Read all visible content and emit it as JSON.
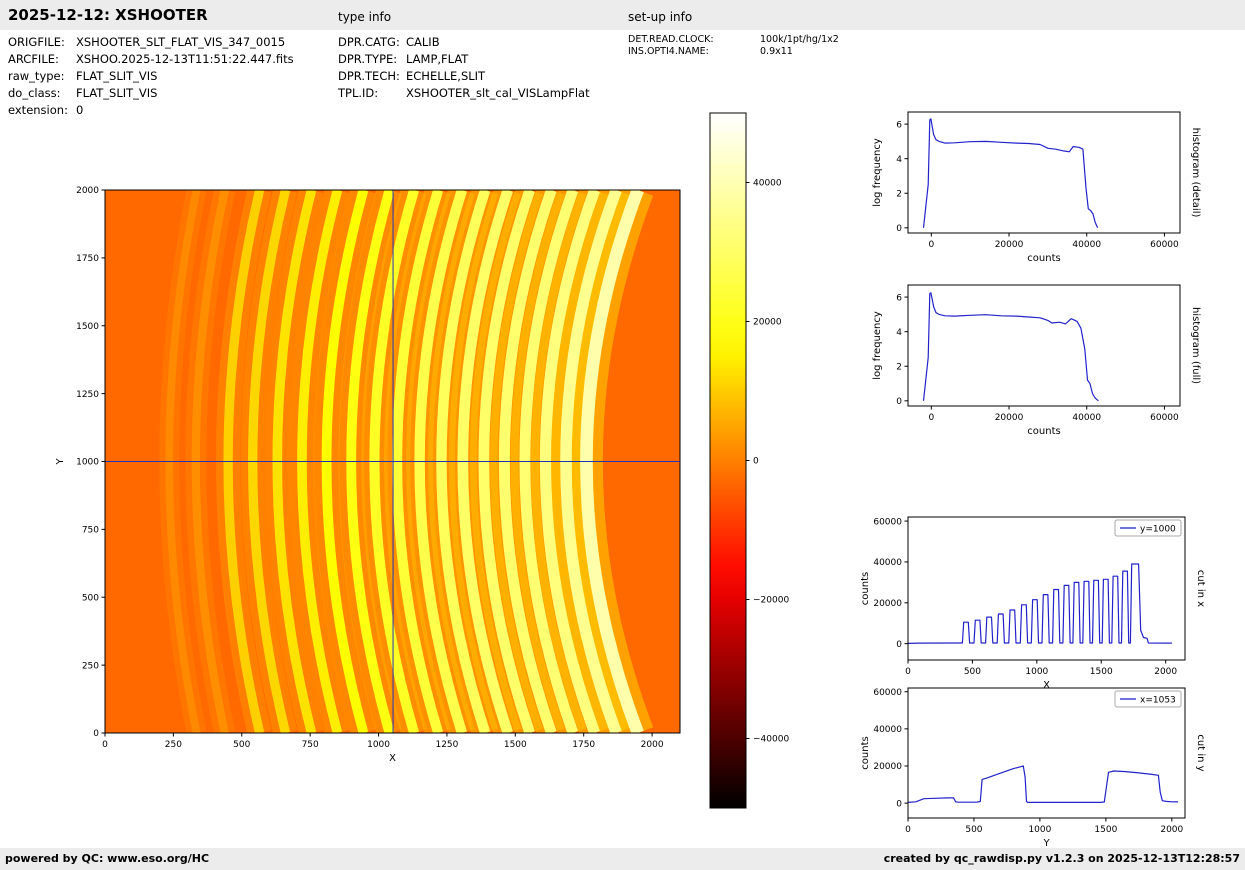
{
  "header": {
    "title": "2025-12-12: XSHOOTER",
    "type_info_label": "type info",
    "setup_info_label": "set-up info"
  },
  "file_info": {
    "rows": [
      {
        "label": "ORIGFILE:",
        "value": "XSHOOTER_SLT_FLAT_VIS_347_0015"
      },
      {
        "label": "ARCFILE:",
        "value": "XSHOO.2025-12-13T11:51:22.447.fits"
      },
      {
        "label": "raw_type:",
        "value": "FLAT_SLIT_VIS"
      },
      {
        "label": "do_class:",
        "value": "FLAT_SLIT_VIS"
      },
      {
        "label": "extension:",
        "value": "0"
      }
    ]
  },
  "type_info": {
    "rows": [
      {
        "label": "DPR.CATG:",
        "value": "CALIB"
      },
      {
        "label": "DPR.TYPE:",
        "value": "LAMP,FLAT"
      },
      {
        "label": "DPR.TECH:",
        "value": "ECHELLE,SLIT"
      },
      {
        "label": "TPL.ID:",
        "value": "XSHOOTER_slt_cal_VISLampFlat"
      }
    ]
  },
  "setup_info": {
    "rows": [
      {
        "label": "DET.READ.CLOCK:",
        "value": "100k/1pt/hg/1x2"
      },
      {
        "label": "INS.OPTI4.NAME:",
        "value": "0.9x11"
      }
    ]
  },
  "footer": {
    "left": "powered by QC: www.eso.org/HC",
    "right": "created by qc_rawdisp.py v1.2.3 on 2025-12-13T12:28:57"
  },
  "chart_data": [
    {
      "id": "main_image",
      "type": "heatmap",
      "xlabel": "X",
      "ylabel": "Y",
      "xlim": [
        0,
        2102
      ],
      "ylim": [
        0,
        2000
      ],
      "xticks": [
        0,
        250,
        500,
        750,
        1000,
        1250,
        1500,
        1750,
        2000
      ],
      "yticks": [
        0,
        250,
        500,
        750,
        1000,
        1250,
        1500,
        1750,
        2000
      ],
      "colormap": "hot",
      "vmin": -50000,
      "vmax": 50000,
      "background_counts": -3000,
      "colorbar_ticks": [
        40000,
        20000,
        0,
        -20000,
        -40000
      ],
      "crosshair": {
        "x": 1053,
        "y": 1000,
        "color": "#2233bb"
      },
      "description": "XSHOOTER VIS lamp flat: ~17 curved echelle orders, brightness increasing from left (~10000 counts) to right (~39000 counts) on an orange background, blue crosshair at x=1053 y=1000",
      "orders": [
        {
          "x": 235,
          "w": 28,
          "p": 1200,
          "d": 100
        },
        {
          "x": 332,
          "w": 30,
          "p": 2000,
          "d": 106
        },
        {
          "x": 450,
          "w": 34,
          "p": 10500,
          "d": 115
        },
        {
          "x": 540,
          "w": 34,
          "p": 11500,
          "d": 120
        },
        {
          "x": 630,
          "w": 35,
          "p": 13000,
          "d": 125
        },
        {
          "x": 720,
          "w": 35,
          "p": 14500,
          "d": 130
        },
        {
          "x": 810,
          "w": 36,
          "p": 16500,
          "d": 135
        },
        {
          "x": 900,
          "w": 36,
          "p": 19000,
          "d": 140
        },
        {
          "x": 985,
          "w": 37,
          "p": 21500,
          "d": 145
        },
        {
          "x": 1068,
          "w": 37,
          "p": 24000,
          "d": 150
        },
        {
          "x": 1150,
          "w": 38,
          "p": 26500,
          "d": 155
        },
        {
          "x": 1230,
          "w": 38,
          "p": 28500,
          "d": 160
        },
        {
          "x": 1308,
          "w": 39,
          "p": 30000,
          "d": 165
        },
        {
          "x": 1385,
          "w": 39,
          "p": 30500,
          "d": 168
        },
        {
          "x": 1460,
          "w": 40,
          "p": 31000,
          "d": 172
        },
        {
          "x": 1535,
          "w": 40,
          "p": 31500,
          "d": 176
        },
        {
          "x": 1610,
          "w": 41,
          "p": 33000,
          "d": 180
        },
        {
          "x": 1685,
          "w": 42,
          "p": 35500,
          "d": 184
        },
        {
          "x": 1760,
          "w": 46,
          "p": 39000,
          "d": 188
        }
      ]
    },
    {
      "id": "histogram_detail",
      "type": "line",
      "right_label": "histogram (detail)",
      "xlabel": "counts",
      "ylabel": "log frequency",
      "line_color": "#2222cc",
      "xlim": [
        -6000,
        64000
      ],
      "ylim": [
        -0.3,
        6.7
      ],
      "xticks": [
        0,
        20000,
        40000,
        60000
      ],
      "yticks": [
        0,
        2,
        4,
        6
      ],
      "x": [
        -2000,
        -800,
        -400,
        -100,
        200,
        600,
        1200,
        2000,
        3500,
        6000,
        10000,
        14000,
        18000,
        22000,
        25000,
        28000,
        30000,
        32000,
        34000,
        35500,
        36500,
        38000,
        39000,
        39800,
        40400,
        41000,
        41600,
        42200,
        42800
      ],
      "y": [
        0,
        2.5,
        6.25,
        6.3,
        5.9,
        5.4,
        5.1,
        5.0,
        4.9,
        4.92,
        4.98,
        5.0,
        4.95,
        4.9,
        4.88,
        4.82,
        4.6,
        4.55,
        4.45,
        4.4,
        4.7,
        4.66,
        4.55,
        2.3,
        1.1,
        1.0,
        0.8,
        0.3,
        0
      ]
    },
    {
      "id": "histogram_full",
      "type": "line",
      "right_label": "histogram (full)",
      "xlabel": "counts",
      "ylabel": "log frequency",
      "line_color": "#2222cc",
      "xlim": [
        -6000,
        64000
      ],
      "ylim": [
        -0.3,
        6.7
      ],
      "xticks": [
        0,
        20000,
        40000,
        60000
      ],
      "yticks": [
        0,
        2,
        4,
        6
      ],
      "x": [
        -2000,
        -800,
        -400,
        -100,
        200,
        600,
        1200,
        2000,
        3500,
        6000,
        10000,
        14000,
        18000,
        22000,
        25000,
        28000,
        30000,
        31000,
        33000,
        34500,
        36000,
        37500,
        38500,
        39500,
        40200,
        40800,
        41500,
        42200,
        43000
      ],
      "y": [
        0,
        2.5,
        6.2,
        6.25,
        5.9,
        5.45,
        5.1,
        5.0,
        4.92,
        4.9,
        4.95,
        4.98,
        4.92,
        4.9,
        4.85,
        4.8,
        4.65,
        4.5,
        4.55,
        4.45,
        4.75,
        4.6,
        4.2,
        3.0,
        1.2,
        1.0,
        0.4,
        0.15,
        0
      ]
    },
    {
      "id": "cut_in_x",
      "type": "line",
      "right_label": "cut in x",
      "legend_label": "y=1000",
      "xlabel": "X",
      "ylabel": "counts",
      "line_color": "#2222cc",
      "xlim": [
        0,
        2150
      ],
      "ylim": [
        -8000,
        62000
      ],
      "xticks": [
        0,
        500,
        1000,
        1500,
        2000
      ],
      "yticks": [
        0,
        20000,
        40000,
        60000
      ],
      "points": [
        [
          0,
          150
        ],
        [
          80,
          250
        ],
        [
          360,
          300
        ],
        [
          415,
          300
        ],
        [
          422,
          300
        ],
        [
          432,
          10500
        ],
        [
          468,
          10500
        ],
        [
          478,
          300
        ],
        [
          512,
          300
        ],
        [
          522,
          11500
        ],
        [
          558,
          11500
        ],
        [
          568,
          300
        ],
        [
          602,
          300
        ],
        [
          612,
          13000
        ],
        [
          648,
          13000
        ],
        [
          658,
          300
        ],
        [
          692,
          300
        ],
        [
          702,
          14500
        ],
        [
          738,
          14500
        ],
        [
          748,
          300
        ],
        [
          782,
          300
        ],
        [
          792,
          16500
        ],
        [
          828,
          16500
        ],
        [
          838,
          300
        ],
        [
          872,
          300
        ],
        [
          882,
          19000
        ],
        [
          918,
          19000
        ],
        [
          928,
          300
        ],
        [
          957,
          300
        ],
        [
          967,
          21500
        ],
        [
          1003,
          21500
        ],
        [
          1013,
          300
        ],
        [
          1040,
          300
        ],
        [
          1050,
          24000
        ],
        [
          1086,
          24000
        ],
        [
          1096,
          300
        ],
        [
          1122,
          300
        ],
        [
          1132,
          26500
        ],
        [
          1168,
          26500
        ],
        [
          1178,
          300
        ],
        [
          1202,
          300
        ],
        [
          1212,
          28500
        ],
        [
          1248,
          28500
        ],
        [
          1258,
          300
        ],
        [
          1280,
          300
        ],
        [
          1290,
          30000
        ],
        [
          1326,
          30000
        ],
        [
          1336,
          300
        ],
        [
          1357,
          300
        ],
        [
          1367,
          30500
        ],
        [
          1403,
          30500
        ],
        [
          1413,
          300
        ],
        [
          1432,
          300
        ],
        [
          1442,
          31000
        ],
        [
          1478,
          31000
        ],
        [
          1488,
          300
        ],
        [
          1507,
          300
        ],
        [
          1517,
          31500
        ],
        [
          1553,
          31500
        ],
        [
          1563,
          300
        ],
        [
          1582,
          300
        ],
        [
          1592,
          33000
        ],
        [
          1628,
          33000
        ],
        [
          1638,
          300
        ],
        [
          1657,
          300
        ],
        [
          1667,
          35500
        ],
        [
          1703,
          35500
        ],
        [
          1713,
          300
        ],
        [
          1726,
          300
        ],
        [
          1736,
          39000
        ],
        [
          1790,
          39000
        ],
        [
          1806,
          6500
        ],
        [
          1828,
          3000
        ],
        [
          1856,
          2600
        ],
        [
          1866,
          300
        ],
        [
          2048,
          250
        ]
      ]
    },
    {
      "id": "cut_in_y",
      "type": "line",
      "right_label": "cut in y",
      "legend_label": "x=1053",
      "xlabel": "Y",
      "ylabel": "counts",
      "line_color": "#2222cc",
      "xlim": [
        0,
        2100
      ],
      "ylim": [
        -8000,
        62000
      ],
      "xticks": [
        0,
        500,
        1000,
        1500,
        2000
      ],
      "yticks": [
        0,
        20000,
        40000,
        60000
      ],
      "points": [
        [
          0,
          400
        ],
        [
          60,
          700
        ],
        [
          120,
          2400
        ],
        [
          200,
          2600
        ],
        [
          300,
          2800
        ],
        [
          345,
          2900
        ],
        [
          362,
          700
        ],
        [
          380,
          500
        ],
        [
          520,
          500
        ],
        [
          548,
          900
        ],
        [
          562,
          12800
        ],
        [
          600,
          13600
        ],
        [
          700,
          16100
        ],
        [
          800,
          18600
        ],
        [
          858,
          19700
        ],
        [
          874,
          20000
        ],
        [
          888,
          14000
        ],
        [
          898,
          900
        ],
        [
          908,
          400
        ],
        [
          1455,
          400
        ],
        [
          1488,
          600
        ],
        [
          1505,
          9000
        ],
        [
          1520,
          16600
        ],
        [
          1560,
          17300
        ],
        [
          1650,
          17000
        ],
        [
          1750,
          16300
        ],
        [
          1850,
          15500
        ],
        [
          1898,
          15000
        ],
        [
          1912,
          6000
        ],
        [
          1928,
          1300
        ],
        [
          1958,
          950
        ],
        [
          2000,
          750
        ],
        [
          2048,
          650
        ]
      ]
    }
  ]
}
